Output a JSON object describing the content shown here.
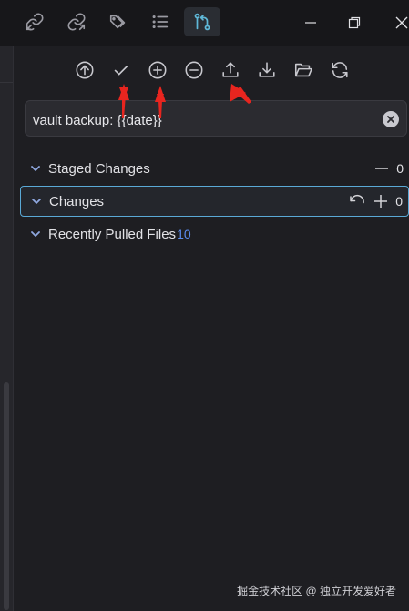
{
  "tabs": [
    {
      "icon": "link-in-icon",
      "active": false
    },
    {
      "icon": "link-out-icon",
      "active": false
    },
    {
      "icon": "tags-icon",
      "active": false
    },
    {
      "icon": "list-icon",
      "active": false
    },
    {
      "icon": "git-branch-icon",
      "active": true
    }
  ],
  "window": {
    "minimize_icon": "minimize-icon",
    "restore_icon": "restore-icon",
    "close_icon": "close-icon"
  },
  "toolbar": [
    {
      "icon": "push-circle-icon",
      "action": "push"
    },
    {
      "icon": "checkmark-icon",
      "action": "commit"
    },
    {
      "icon": "plus-circle-icon",
      "action": "stage-all"
    },
    {
      "icon": "minus-circle-icon",
      "action": "unstage-all"
    },
    {
      "icon": "upload-icon",
      "action": "push"
    },
    {
      "icon": "download-icon",
      "action": "pull"
    },
    {
      "icon": "folder-open-icon",
      "action": "open"
    },
    {
      "icon": "refresh-icon",
      "action": "refresh"
    }
  ],
  "commit": {
    "value": "vault backup: {{date}}"
  },
  "sections": {
    "staged": {
      "title": "Staged Changes",
      "count": "0"
    },
    "changes": {
      "title": "Changes",
      "count": "0"
    },
    "pulled": {
      "title": "Recently Pulled Files",
      "count": "10"
    }
  },
  "colors": {
    "focus_border": "#5aa9d6",
    "count_blue": "#5b8cf0",
    "annotation_red": "#e8251f"
  },
  "watermark": "掘金技术社区 @ 独立开发爱好者"
}
